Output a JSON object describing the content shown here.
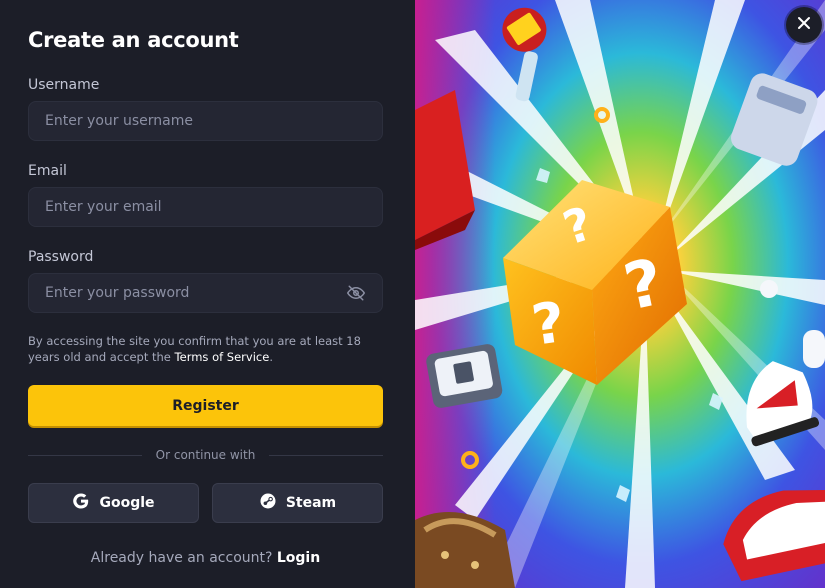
{
  "form": {
    "title": "Create an account",
    "username": {
      "label": "Username",
      "placeholder": "Enter your username",
      "value": ""
    },
    "email": {
      "label": "Email",
      "placeholder": "Enter your email",
      "value": ""
    },
    "password": {
      "label": "Password",
      "placeholder": "Enter your password",
      "value": "",
      "toggle_icon": "eye-off-icon"
    },
    "terms": {
      "text": "By accessing the site you confirm that you are at least 18 years old and accept the",
      "link": "Terms of Service",
      "suffix": "."
    },
    "register_label": "Register",
    "divider_text": "Or continue with",
    "social": [
      {
        "label": "Google",
        "icon": "google-icon"
      },
      {
        "label": "Steam",
        "icon": "steam-icon"
      }
    ],
    "login_prompt": "Already have an account?",
    "login_link": "Login"
  },
  "colors": {
    "panel_bg": "#1c1e28",
    "input_bg": "#242633",
    "accent": "#fcc40a",
    "social_bg": "#2c2f3e"
  },
  "close_icon": "close-icon",
  "illustration": "mystery-box-illustration"
}
